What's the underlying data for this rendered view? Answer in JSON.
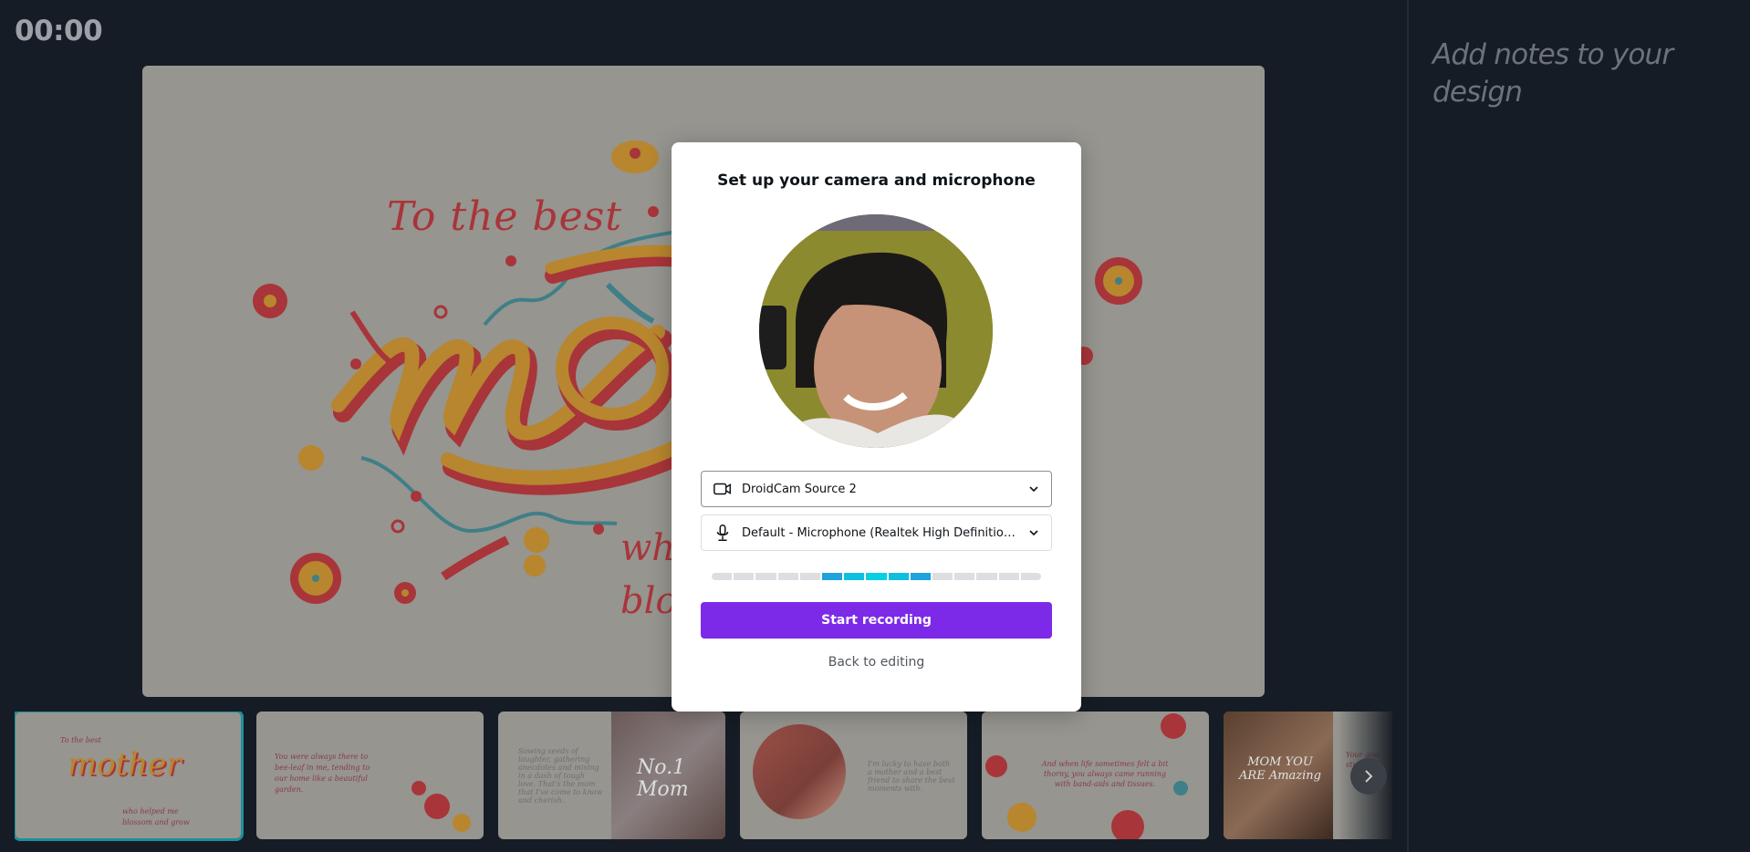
{
  "timer": "00:00",
  "notes_placeholder": "Add notes to your design",
  "slide": {
    "title_text": "To the best",
    "headline": "mother",
    "subtitle_lines": [
      "who helped me",
      "blossom and grow"
    ],
    "colors": {
      "background": "#96958f",
      "red": "#a8353a",
      "gold": "#b7862e",
      "teal": "#3f7f87"
    }
  },
  "modal": {
    "title": "Set up your camera and microphone",
    "camera_select": {
      "icon": "video-camera-icon",
      "value": "DroidCam Source 2"
    },
    "microphone_select": {
      "icon": "microphone-icon",
      "value": "Default - Microphone (Realtek High Definition Audio)"
    },
    "level_meter": {
      "segments": 15,
      "active_from": 6,
      "active_to": 10
    },
    "primary_button": "Start recording",
    "secondary_link": "Back to editing",
    "accent_color": "#7d2ae8"
  },
  "thumbnails": [
    {
      "index": 1,
      "active": true,
      "lines": [
        "To the best",
        "mother",
        "who helped me",
        "blossom and grow"
      ]
    },
    {
      "index": 2,
      "active": false,
      "lines": [
        "You were always there to",
        "bee-leaf in me, tending to",
        "our home like a beautiful",
        "garden."
      ]
    },
    {
      "index": 3,
      "active": false,
      "lines": [
        "Sowing seeds of",
        "laughter, gathering",
        "anecdotes and mixing",
        "in a dash of tough",
        "love. That's the mom",
        "that I've come to know",
        "and cherish."
      ],
      "overlay_text": "No.1 Mom"
    },
    {
      "index": 4,
      "active": false,
      "lines": [
        "I'm lucky to have both",
        "a mother and a best",
        "friend to share the best",
        "moments with."
      ]
    },
    {
      "index": 5,
      "active": false,
      "lines": [
        "And when life sometimes felt a bit",
        "thorny, you always came running",
        "with band-aids and tissues."
      ]
    },
    {
      "index": 6,
      "active": false,
      "overlay_text": "MOM YOU ARE Amazing",
      "lines": [
        "Your goo",
        "strength"
      ]
    }
  ],
  "next_button_icon": "chevron-right-icon"
}
